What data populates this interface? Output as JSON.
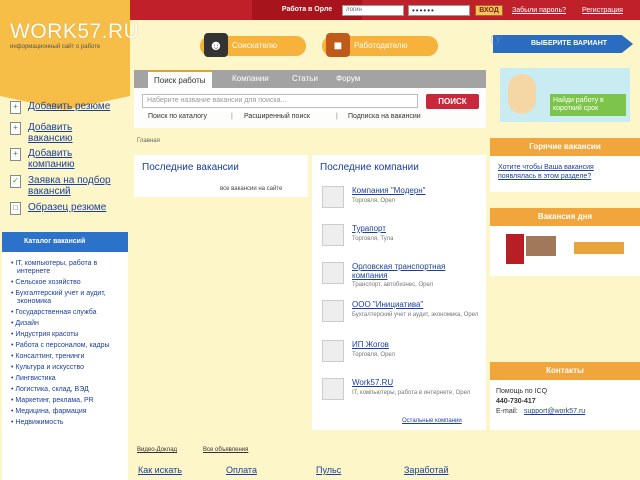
{
  "header": {
    "logo": "WORK57.RU",
    "logo_subtitle": "информационный сайт о работе",
    "city": "Работа в Орле",
    "login_placeholder": "логин",
    "password_mask": "••••••",
    "login_button": "ВХОД",
    "forgot_password": "Забыли пароль?",
    "register": "Регистрация",
    "applicant_button": "Соискателю",
    "employer_button": "Работодателю",
    "choose_option": "ВЫБЕРИТЕ ВАРИАНТ"
  },
  "sidebar": {
    "actions": [
      {
        "label": "Добавить резюме"
      },
      {
        "label": "Добавить вакансию"
      },
      {
        "label": "Добавить компанию"
      },
      {
        "label": "Заявка на подбор вакансий"
      },
      {
        "label": "Образец резюме"
      }
    ],
    "catalog_title": "Каталог вакансий",
    "catalog": [
      "IT, компьютеры, работа в интернете",
      "Сельское хозяйство",
      "Бухгалтерский учет и аудит, экономика",
      "Государственная служба",
      "Дизайн",
      "Индустрия красоты",
      "Работа с персоналом, кадры",
      "Консалтинг, тренинги",
      "Культура и искусство",
      "Лингвистика",
      "Логистика, склад, ВЭД",
      "Маркетинг, реклама, PR",
      "Медицина, фармация",
      "Недвижимость"
    ]
  },
  "search": {
    "tabs": [
      "Поиск работы",
      "Компании",
      "Статьи",
      "Форум"
    ],
    "placeholder": "Наберите название вакансии для поиска...",
    "button": "ПОИСК",
    "links": [
      "Поиск по каталогу",
      "Расширенный поиск",
      "Подписка на вакансии"
    ]
  },
  "breadcrumb": "Главная",
  "latest_vacancies": {
    "title": "Последние вакансии",
    "all_link": "все вакансии на сайте"
  },
  "latest_companies": {
    "title": "Последние компании",
    "items": [
      {
        "name": "Компания \"Модерн\"",
        "desc": "Торговля, Орел"
      },
      {
        "name": "Турапорт",
        "desc": "Торговля, Тула"
      },
      {
        "name": "Орловская транспортная компания",
        "desc": "Транспорт, автобизнес, Орел"
      },
      {
        "name": "ООО \"Инициатива\"",
        "desc": "Бухгалтерский учет и аудит, экономика, Орел"
      },
      {
        "name": "ИП Жогов",
        "desc": "Торговля, Орел"
      },
      {
        "name": "Work57.RU",
        "desc": "IT, компьютеры, работа в интернете, Орел"
      }
    ],
    "all_link": "Остальные компании"
  },
  "right": {
    "banner_text": "Найди работу в короткий срок",
    "hot_title": "Горячие вакансии",
    "hot_link": "Хотите чтобы Ваша вакансия появлялась в этом разделе?",
    "day_title": "Вакансия дня",
    "contacts_title": "Контакты",
    "icq": "Помощь по ICQ",
    "icq_number": "440-730-417",
    "email_label": "E-mail:",
    "email": "support@work57.ru"
  },
  "bottom": {
    "tabs": [
      "Видео-Доклад",
      "Все объявления"
    ],
    "cols": [
      "Как искать",
      "Оплата",
      "Пульс",
      "Заработай"
    ]
  },
  "colors": {
    "accent": "#f6be46",
    "header": "#c0202a",
    "link": "#1a3f9e",
    "search": "#c9283a"
  }
}
